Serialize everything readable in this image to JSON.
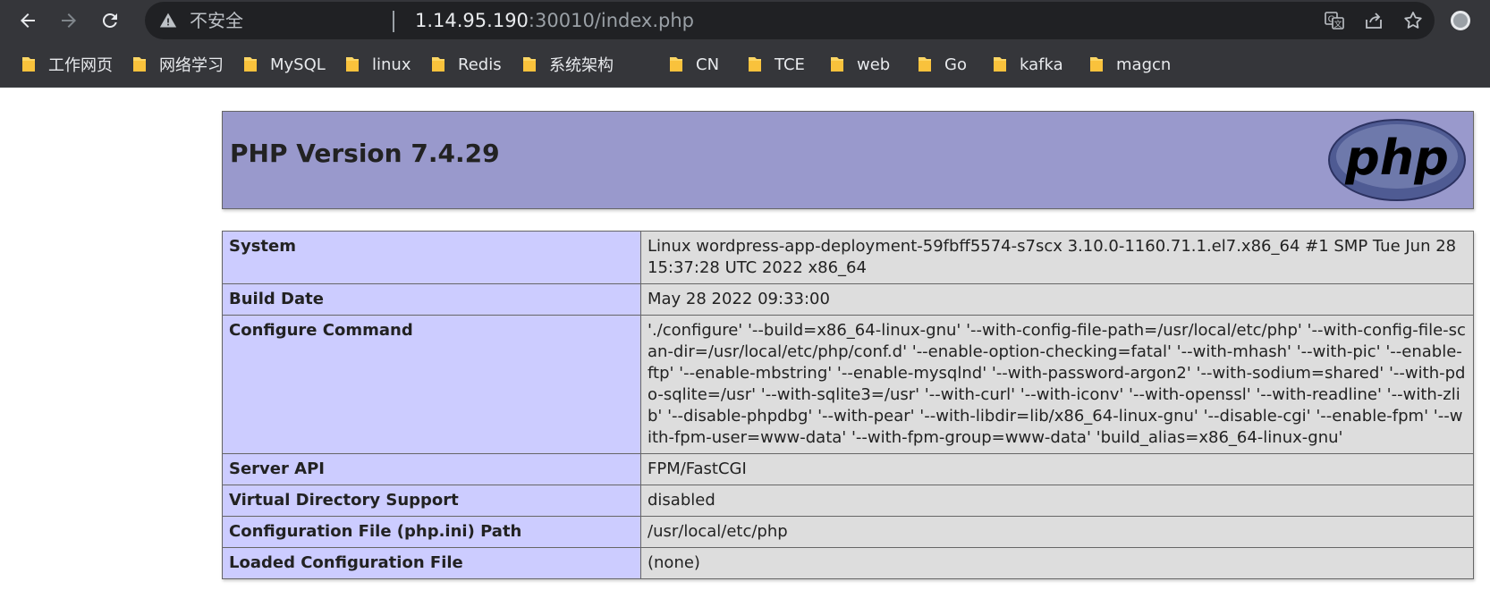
{
  "browser": {
    "security_label": "不安全",
    "url_host": "1.14.95.190",
    "url_rest": ":30010/index.php",
    "icons": [
      "back-arrow-icon",
      "forward-arrow-icon",
      "reload-icon",
      "warning-icon",
      "translate-icon",
      "share-icon",
      "star-icon",
      "profile-icon"
    ]
  },
  "bookmarks": [
    {
      "label": "工作网页"
    },
    {
      "label": "网络学习"
    },
    {
      "label": "MySQL"
    },
    {
      "label": "linux"
    },
    {
      "label": "Redis"
    },
    {
      "label": "系统架构"
    },
    {
      "label": "CN"
    },
    {
      "label": "TCE"
    },
    {
      "label": "web"
    },
    {
      "label": "Go"
    },
    {
      "label": "kafka"
    },
    {
      "label": "magcn"
    }
  ],
  "page": {
    "title": "PHP Version 7.4.29",
    "logo_text": "php",
    "colors": {
      "header_bg": "#9999cc",
      "key_bg": "#ccccff",
      "value_bg": "#dddddd",
      "border": "#666666"
    },
    "rows": [
      {
        "key": "System",
        "value": "Linux wordpress-app-deployment-59fbff5574-s7scx 3.10.0-1160.71.1.el7.x86_64 #1 SMP Tue Jun 28 15:37:28 UTC 2022 x86_64"
      },
      {
        "key": "Build Date",
        "value": "May 28 2022 09:33:00"
      },
      {
        "key": "Configure Command",
        "value": "'./configure' '--build=x86_64-linux-gnu' '--with-config-file-path=/usr/local/etc/php' '--with-config-file-scan-dir=/usr/local/etc/php/conf.d' '--enable-option-checking=fatal' '--with-mhash' '--with-pic' '--enable-ftp' '--enable-mbstring' '--enable-mysqlnd' '--with-password-argon2' '--with-sodium=shared' '--with-pdo-sqlite=/usr' '--with-sqlite3=/usr' '--with-curl' '--with-iconv' '--with-openssl' '--with-readline' '--with-zlib' '--disable-phpdbg' '--with-pear' '--with-libdir=lib/x86_64-linux-gnu' '--disable-cgi' '--enable-fpm' '--with-fpm-user=www-data' '--with-fpm-group=www-data' 'build_alias=x86_64-linux-gnu'"
      },
      {
        "key": "Server API",
        "value": "FPM/FastCGI"
      },
      {
        "key": "Virtual Directory Support",
        "value": "disabled"
      },
      {
        "key": "Configuration File (php.ini) Path",
        "value": "/usr/local/etc/php"
      },
      {
        "key": "Loaded Configuration File",
        "value": "(none)"
      }
    ]
  }
}
